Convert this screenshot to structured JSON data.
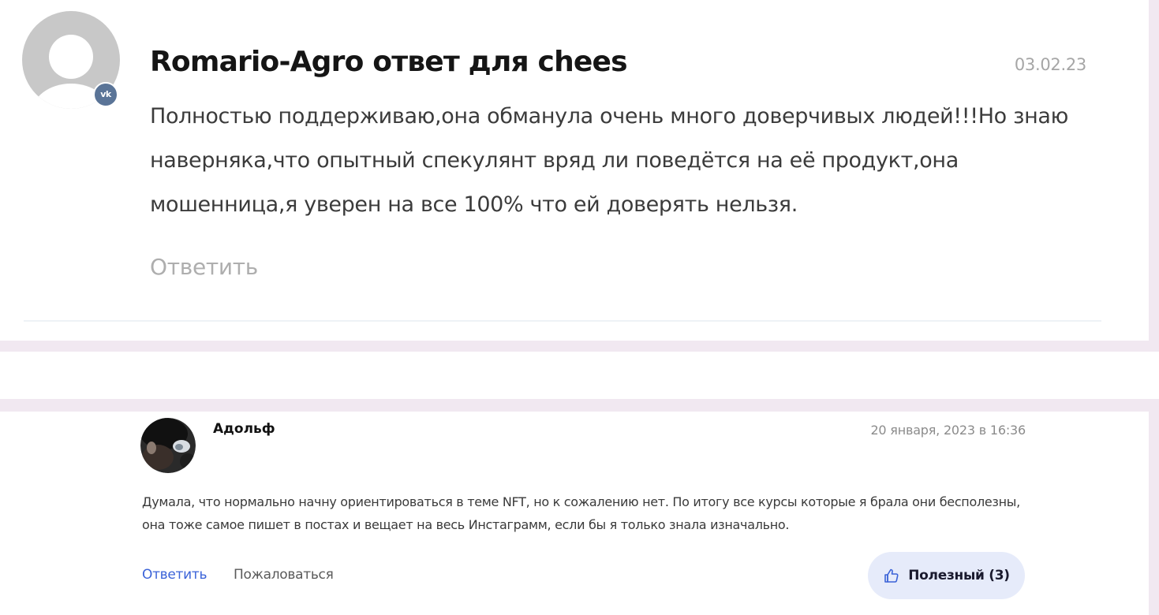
{
  "top_comment": {
    "title": "Romario-Agro ответ для chees",
    "date": "03.02.23",
    "body": "Полностью поддерживаю,она обманула очень много доверчивых людей!!!Но знаю наверняка,что опытный спекулянт вряд ли поведётся на её продукт,она мошенница,я уверен на все 100% что ей доверять нельзя.",
    "reply_label": "Ответить",
    "avatar_icon": "default-user-avatar-icon",
    "badge_icon": "vk-icon",
    "badge_text": "vk",
    "badge_color": "#5a7497"
  },
  "second_comment": {
    "author": "Адольф",
    "date": "20 января, 2023 в 16:36",
    "body": "Думала, что нормально начну ориентироваться в теме NFT, но к сожалению нет. По итогу все курсы которые я брала они бесполезны, она тоже самое пишет в постах и вещает на весь Инстаграмм, если бы я только знала изначально.",
    "reply_label": "Ответить",
    "complain_label": "Пожаловаться",
    "useful_label": "Полезный (3)",
    "useful_icon": "thumbs-up-icon",
    "link_color": "#3b63d8",
    "button_bg": "#e6ebfa"
  },
  "colors": {
    "separator": "#f1e8f1",
    "title_text": "#151515",
    "muted_text": "#a6a6a6"
  }
}
